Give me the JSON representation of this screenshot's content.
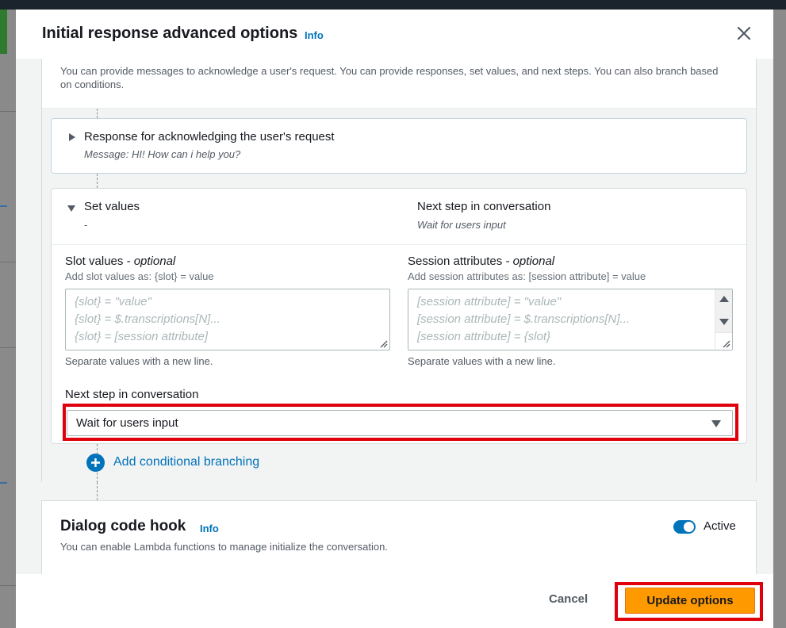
{
  "modal": {
    "title": "Initial response advanced options",
    "info_label": "Info",
    "close_icon": "close-icon"
  },
  "response_section": {
    "description": "You can provide messages to acknowledge a user's request. You can provide responses, set values, and next steps. You can also branch based on conditions.",
    "ack_card": {
      "heading": "Response for acknowledging the user's request",
      "message": "Message: HI! How can i help you?",
      "expanded": false
    },
    "set_values_card": {
      "heading": "Set values",
      "summary": "-",
      "next_step_heading": "Next step in conversation",
      "next_step_summary": "Wait for users input",
      "expanded": true,
      "slot_values": {
        "label": "Slot values",
        "optional": "- optional",
        "description": "Add slot values as: {slot} = value",
        "placeholder_lines": [
          "{slot} = \"value\"",
          "{slot} = $.transcriptions[N]...",
          "{slot} = [session attribute]"
        ],
        "hint": "Separate values with a new line."
      },
      "session_attributes": {
        "label": "Session attributes",
        "optional": "- optional",
        "description": "Add session attributes as: [session attribute] = value",
        "placeholder_lines": [
          "[session attribute] = \"value\"",
          "[session attribute] = $.transcriptions[N]...",
          "[session attribute] = {slot}"
        ],
        "hint": "Separate values with a new line."
      },
      "next_step": {
        "label": "Next step in conversation",
        "selected": "Wait for users input"
      }
    },
    "add_branching_label": "Add conditional branching"
  },
  "dialog_code_hook": {
    "title": "Dialog code hook",
    "info_label": "Info",
    "description": "You can enable Lambda functions to manage initialize the conversation.",
    "toggle_label": "Active",
    "active": true
  },
  "footer": {
    "cancel_label": "Cancel",
    "update_label": "Update options"
  },
  "colors": {
    "accent": "#0073bb",
    "primary_button": "#ff9900",
    "highlight": "#e0000b"
  }
}
